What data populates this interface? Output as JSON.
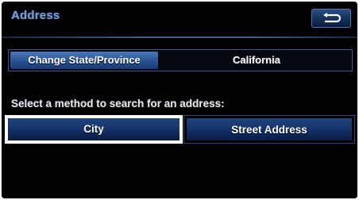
{
  "header": {
    "title": "Address",
    "back_icon": "return-arrow-icon"
  },
  "state_row": {
    "button_label": "Change State/Province",
    "current_value": "California"
  },
  "search": {
    "prompt": "Select a method to search for an address:",
    "options": [
      {
        "label": "City",
        "selected": true
      },
      {
        "label": "Street Address",
        "selected": false
      }
    ]
  },
  "colors": {
    "background": "#020204",
    "title": "#7f9fd4",
    "button_blue": "#2b5596",
    "selection_outline": "#ffffff"
  }
}
